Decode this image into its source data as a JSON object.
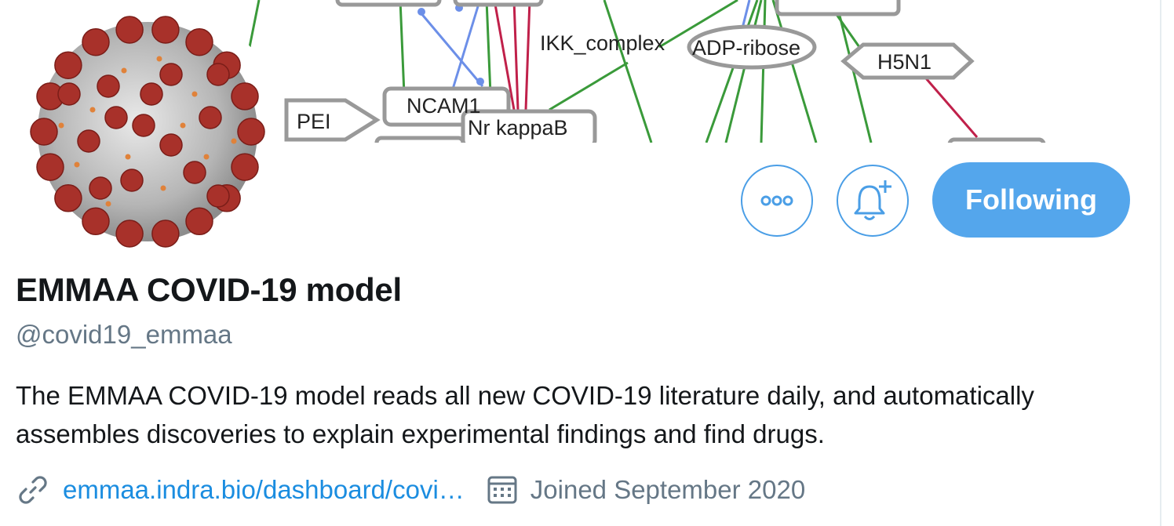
{
  "banner": {
    "nodes": [
      "IKK_complex",
      "ADP-ribose",
      "H5N1",
      "NCAM1",
      "PEI",
      "NFkappaB"
    ],
    "node_texts": {
      "ikk": "IKK_complex",
      "adp": "ADP-ribose",
      "h5n1": "H5N1",
      "ncam1": "NCAM1",
      "pei": "PEI",
      "nfkb": "Nr kappaB"
    }
  },
  "actions": {
    "more_icon": "more-dots-icon",
    "notify_icon": "bell-plus-icon",
    "following_label": "Following"
  },
  "profile": {
    "display_name": "EMMAA COVID-19 model",
    "handle": "@covid19_emmaa",
    "bio": "The EMMAA COVID-19 model reads all new COVID-19 literature daily, and automatically assembles discoveries to explain experimental findings and find drugs.",
    "website": "emmaa.indra.bio/dashboard/covi…",
    "joined": "Joined September 2020",
    "link_icon": "link-icon",
    "calendar_icon": "calendar-icon"
  },
  "colors": {
    "accent": "#54a6ec",
    "link": "#1b8de0",
    "muted": "#657786",
    "text": "#14171a"
  }
}
